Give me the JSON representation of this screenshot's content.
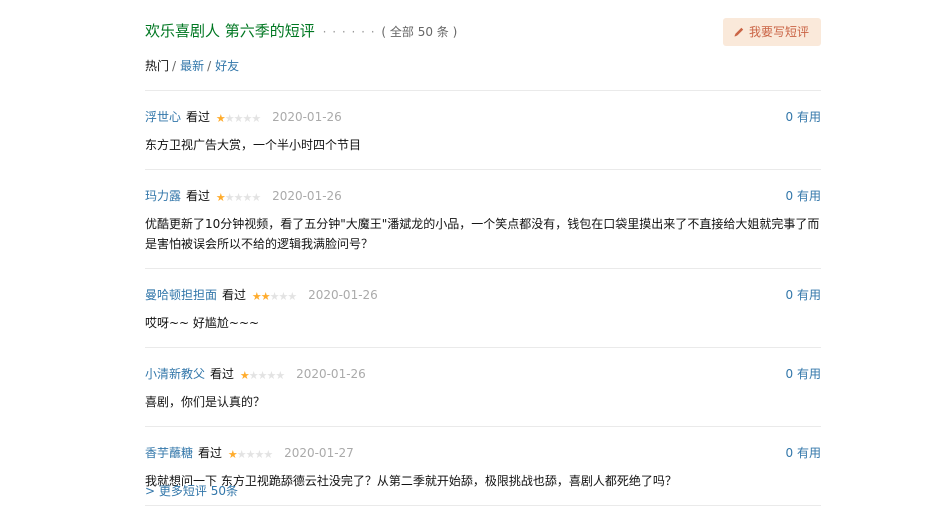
{
  "header": {
    "title": "欢乐喜剧人 第六季的短评",
    "dots": "· · · · · ·",
    "count": "( 全部 50 条 )",
    "write_button": "我要写短评"
  },
  "sort": {
    "hot": "热门",
    "sep1": "/",
    "newest": "最新",
    "sep2": "/",
    "friends": "好友"
  },
  "comments": [
    {
      "user": "浮世心",
      "status": "看过",
      "rating": 1,
      "date": "2020-01-26",
      "votes": "0",
      "votes_label": "有用",
      "text": "东方卫视广告大赏，一个半小时四个节目"
    },
    {
      "user": "玛力露",
      "status": "看过",
      "rating": 1,
      "date": "2020-01-26",
      "votes": "0",
      "votes_label": "有用",
      "text": "优酷更新了10分钟视频，看了五分钟\"大魔王\"潘斌龙的小品，一个笑点都没有，钱包在口袋里摸出来了不直接给大姐就完事了而是害怕被误会所以不给的逻辑我满脸问号？"
    },
    {
      "user": "曼哈顿担担面",
      "status": "看过",
      "rating": 2,
      "date": "2020-01-26",
      "votes": "0",
      "votes_label": "有用",
      "text": "哎呀~~ 好尴尬~~~"
    },
    {
      "user": "小清新教父",
      "status": "看过",
      "rating": 1,
      "date": "2020-01-26",
      "votes": "0",
      "votes_label": "有用",
      "text": "喜剧，你们是认真的？"
    },
    {
      "user": "香芋蘸糖",
      "status": "看过",
      "rating": 1,
      "date": "2020-01-27",
      "votes": "0",
      "votes_label": "有用",
      "text": "我就想问一下 东方卫视跪舔德云社没完了？从第二季就开始舔，极限挑战也舔，喜剧人都死绝了吗？"
    }
  ],
  "more": {
    "arrow": ">",
    "label": "更多短评 50条"
  },
  "colors": {
    "title_green": "#007722",
    "link_blue": "#3377aa",
    "star_on": "#ffac2d",
    "star_off": "#e3e3e3",
    "button_bg": "#fae9da",
    "button_text": "#ca6445"
  },
  "icons": {
    "write_button_icon": "pencil-icon",
    "star_icon": "star-icon"
  }
}
